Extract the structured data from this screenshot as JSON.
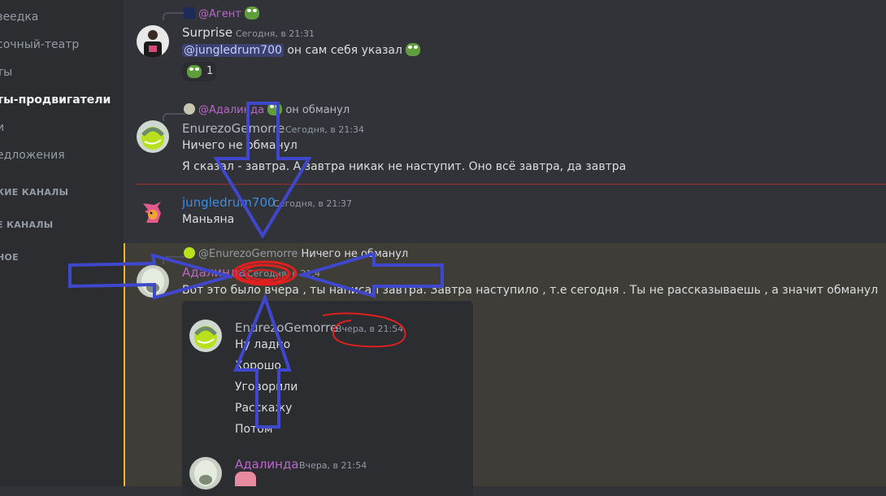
{
  "sidebar": {
    "channels": [
      {
        "label": "зеедка"
      },
      {
        "label": "сочный-театр"
      },
      {
        "label": "ты"
      },
      {
        "label": "ты-продвигатели"
      },
      {
        "label": "и"
      },
      {
        "label": "едложения"
      }
    ],
    "categories": [
      {
        "label": "КИЕ КАНАЛЫ"
      },
      {
        "label": "Е КАНАЛЫ"
      },
      {
        "label": "НОЕ"
      }
    ]
  },
  "messages": {
    "m1": {
      "reply_user": "@Агент",
      "author": "Surprise",
      "timestamp": "Сегодня, в 21:31",
      "mention": "@jungledrum700",
      "text": "он сам себя указал",
      "reaction_count": "1",
      "author_color": "#f2f3f5"
    },
    "m2": {
      "reply_user": "@Адалинда",
      "reply_text": "он обманул",
      "author": "EnurezoGemorre",
      "timestamp": "Сегодня, в 21:34",
      "line1": "Ничего не обманул",
      "line2": "Я сказал - завтра. А завтра никак не наступит. Оно всё завтра, да завтра",
      "author_color": "#b5bac1"
    },
    "m3": {
      "author": "jungledrum700",
      "timestamp": "Сегодня, в 21:37",
      "text": "Маньяна",
      "author_color": "#3a8ee6"
    },
    "m4": {
      "reply_user": "@EnurezoGemorre",
      "reply_text": "Ничего не обманул",
      "author": "Адалинда",
      "timestamp": "Сегодня, в 21:4",
      "text": "Вот это было вчера , ты написал завтра. Завтра наступило , т.е сегодня . Ты не рассказываешь , а значит обманул",
      "author_color": "#b968c7"
    },
    "quote": {
      "author": "EnurezoGemorre",
      "timestamp": "Вчера, в 21:54",
      "lines": [
        "Ну ладно",
        "Хорошо",
        "Уговорили",
        "Расскажу",
        "Потом"
      ],
      "author2": "Адалинда",
      "timestamp2": "Вчера, в 21:54"
    }
  },
  "colors": {
    "arrow": "#3f48cc",
    "marker": "#e0201f"
  }
}
